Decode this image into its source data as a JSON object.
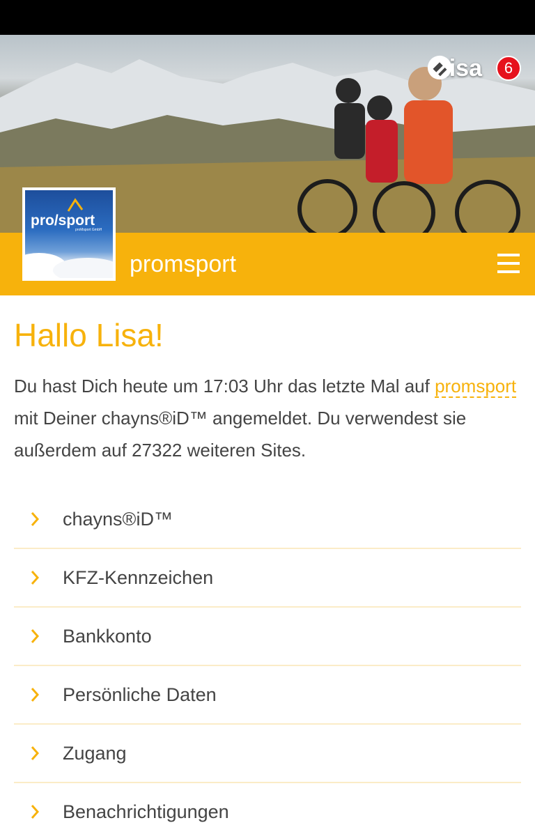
{
  "user": {
    "name": "Lisa",
    "notification_count": "6"
  },
  "site": {
    "title": "promsport",
    "logo_text": "pro/sport",
    "logo_subtext": "proMsport GmbH"
  },
  "greeting": "Hallo Lisa!",
  "info": {
    "before_link": "Du hast Dich heute um 17:03 Uhr das letzte Mal auf ",
    "link": "promsport",
    "after_link": " mit Deiner chayns®iD™ angemeldet. Du verwendest sie außerdem auf 27322 weiteren Sites."
  },
  "accordion": [
    {
      "label": "chayns®iD™"
    },
    {
      "label": "KFZ-Kennzeichen"
    },
    {
      "label": "Bankkonto"
    },
    {
      "label": "Persönliche Daten"
    },
    {
      "label": "Zugang"
    },
    {
      "label": "Benachrichtigungen"
    }
  ],
  "colors": {
    "accent": "#f7b20c",
    "badge": "#e6121d",
    "status_bar": "#000000"
  },
  "icons": {
    "chayns": "chayns-icon",
    "menu": "hamburger-menu-icon",
    "chevron": "chevron-right-icon"
  }
}
